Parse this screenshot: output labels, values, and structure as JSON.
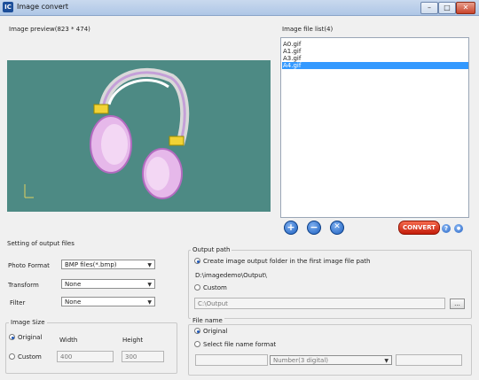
{
  "window": {
    "title": "Image convert",
    "icon": "app-icon",
    "minimize": "–",
    "maximize": "□",
    "close": "✕"
  },
  "preview": {
    "label": "Image preview(823 * 474)"
  },
  "file_list": {
    "label": "Image file list(4)",
    "items": [
      "A0.gif",
      "A1.gif",
      "A3.gif",
      "A4.gif"
    ],
    "selected_index": 3
  },
  "actions": {
    "add": "+",
    "remove": "−",
    "clear": "✕",
    "convert": "CONVERT",
    "help": "?",
    "settings": "●"
  },
  "settings": {
    "group_title": "Setting of output files",
    "photo_format": {
      "label": "Photo Format",
      "value": "BMP files(*.bmp)"
    },
    "transform": {
      "label": "Transform",
      "value": "None"
    },
    "filter": {
      "label": "Filter",
      "value": "None"
    }
  },
  "image_size": {
    "title": "Image Size",
    "original_label": "Original",
    "custom_label": "Custom",
    "width_label": "Width",
    "height_label": "Height",
    "width_value": "400",
    "height_value": "300"
  },
  "output_path": {
    "title": "Output path",
    "option1": "Create image output folder in the first image file path",
    "path_text": "D:\\imagedemo\\Output\\",
    "custom_label": "Custom",
    "custom_path": "C:\\Output",
    "browse": "..."
  },
  "file_name": {
    "title": "File name",
    "original_label": "Original",
    "select_format_label": "Select file name format",
    "format_value": "Number(3 digital)"
  },
  "colors": {
    "accent": "#3399ff",
    "convert": "#d8321b",
    "preview_bg": "#4d8a84"
  }
}
